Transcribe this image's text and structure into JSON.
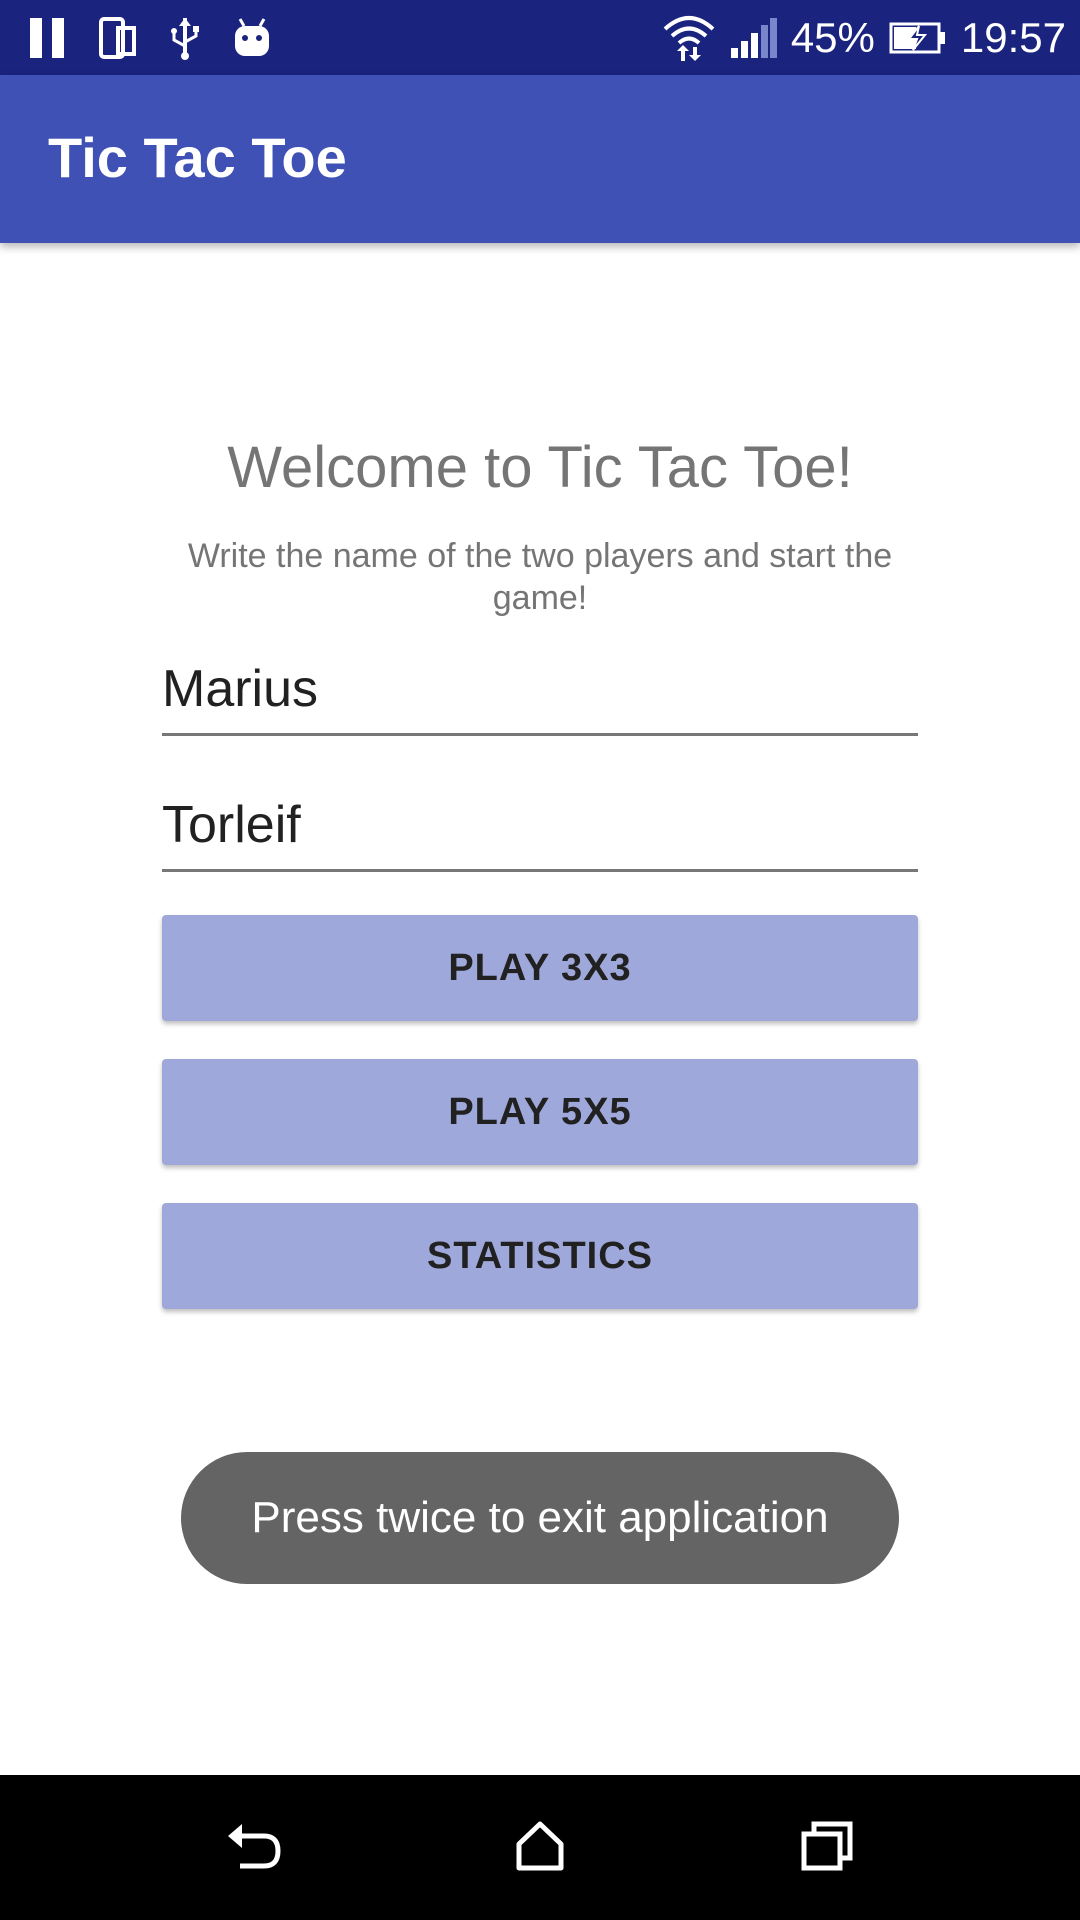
{
  "status_bar": {
    "battery_percent": "45%",
    "time": "19:57",
    "icons": [
      "pause-icon",
      "device-icon",
      "usb-icon",
      "android-icon",
      "wifi-icon",
      "signal-icon",
      "battery-charging-icon"
    ]
  },
  "app_bar": {
    "title": "Tic Tac Toe"
  },
  "main": {
    "welcome_title": "Welcome to Tic Tac Toe!",
    "instructions": "Write the name of the two players and start the game!",
    "player1_name": "Marius",
    "player2_name": "Torleif",
    "buttons": {
      "play3": "PLAY 3X3",
      "play5": "PLAY 5X5",
      "statistics": "STATISTICS"
    }
  },
  "toast": {
    "message": "Press twice to exit application"
  },
  "nav_bar": {
    "icons": [
      "back-icon",
      "home-icon",
      "recent-apps-icon"
    ]
  },
  "colors": {
    "status_bar": "#1a237e",
    "app_bar": "#3f51b5",
    "button": "#9fa8da",
    "toast": "#646464",
    "nav_bar": "#000000"
  }
}
